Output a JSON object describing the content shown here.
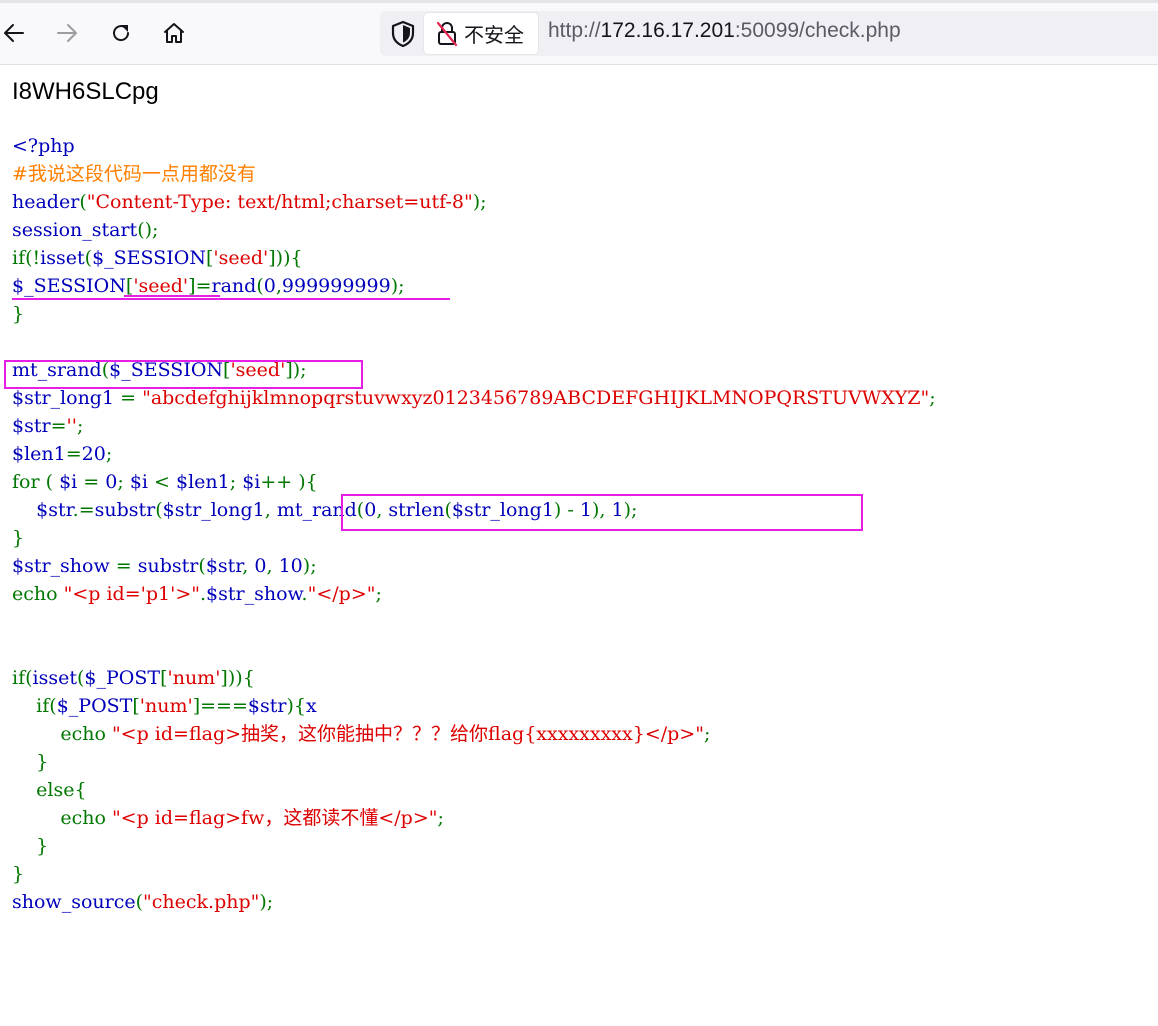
{
  "browser": {
    "security_label": "不安全",
    "url_scheme": "http://",
    "url_host": "172.16.17.201",
    "url_rest": ":50099/check.php",
    "icons": [
      "back-arrow-icon",
      "forward-arrow-icon",
      "reload-icon",
      "home-icon",
      "shield-icon",
      "insecure-lock-icon"
    ]
  },
  "page": {
    "output_text": "I8WH6SLCpg",
    "code_lines": [
      "<?php",
      "#我说这段代码一点用都没有",
      "header(\"Content-Type: text/html;charset=utf-8\");",
      "session_start();",
      "if(!isset($_SESSION['seed'])){",
      "$_SESSION['seed']=rand(0,999999999);",
      "}",
      "",
      "mt_srand($_SESSION['seed']);",
      "$str_long1 = \"abcdefghijklmnopqrstuvwxyz0123456789ABCDEFGHIJKLMNOPQRSTUVWXYZ\";",
      "$str='';",
      "$len1=20;",
      "for ( $i = 0; $i < $len1; $i++ ){",
      "    $str.=substr($str_long1, mt_rand(0, strlen($str_long1) - 1), 1);",
      "}",
      "$str_show = substr($str, 0, 10);",
      "echo \"<p id='p1'>\".$str_show.\"</p>\";",
      "",
      "",
      "if(isset($_POST['num'])){",
      "    if($_POST['num']===$str){x",
      "        echo \"<p id=flag>抽奖，这你能抽中？？？给你flag{xxxxxxxxx}</p>\";",
      "    }",
      "    else{",
      "        echo \"<p id=flag>fw，这都读不懂</p>\";",
      "    }",
      "}",
      "show_source(\"check.php\");"
    ]
  },
  "colors": {
    "annotation": "#e61ee6",
    "code_default": "#0000bb",
    "code_keyword": "#007700",
    "code_string": "#dd0000",
    "code_comment": "#ff8000"
  }
}
